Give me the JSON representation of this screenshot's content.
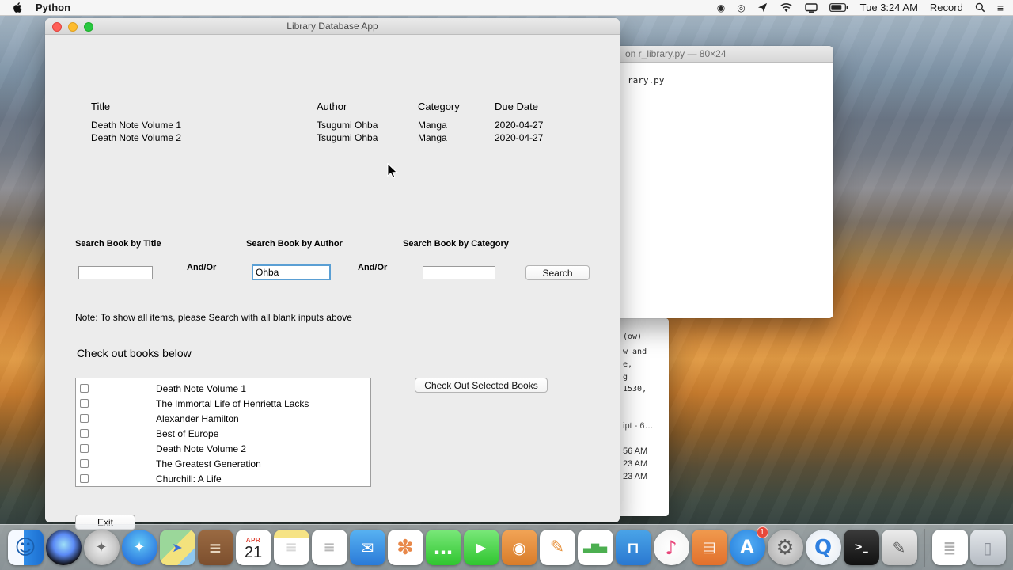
{
  "menu_bar": {
    "app_name": "Python",
    "time": "Tue 3:24 AM",
    "record_label": "Record",
    "icons": [
      "apple-logo",
      "record-stop",
      "screen-mirroring",
      "location",
      "wifi",
      "display",
      "battery",
      "spotlight-search",
      "notification-center"
    ]
  },
  "app_window": {
    "title": "Library Database App",
    "table": {
      "headers": [
        "Title",
        "Author",
        "Category",
        "Due Date"
      ],
      "rows": [
        [
          "Death Note Volume 1",
          "Tsugumi Ohba",
          "Manga",
          "2020-04-27"
        ],
        [
          "Death Note Volume 2",
          "Tsugumi Ohba",
          "Manga",
          "2020-04-27"
        ]
      ]
    },
    "search": {
      "title_label": "Search Book by Title",
      "author_label": "Search Book by Author",
      "category_label": "Search Book by Category",
      "and_or_1": "And/Or",
      "and_or_2": "And/Or",
      "title_value": "",
      "author_value": "Ohba",
      "category_value": "",
      "button": "Search"
    },
    "note": "Note: To show all items, please Search with all blank inputs above",
    "checkout_heading": "Check out books below",
    "books": [
      "Death Note Volume 1",
      "The Immortal Life of Henrietta Lacks",
      "Alexander Hamilton",
      "Best of Europe",
      "Death Note Volume 2",
      "The Greatest Generation",
      "Churchill: A Life"
    ],
    "checkout_button": "Check Out Selected Books",
    "exit_button": "Exit"
  },
  "terminal_window": {
    "title": "on r_library.py — 80×24",
    "visible_line": "rary.py"
  },
  "background_window_fragments": [
    "(ow)",
    "w and",
    "e,",
    "g",
    "1530,",
    "ipt - 6…",
    "56 AM",
    "23 AM",
    "23 AM"
  ],
  "dock": {
    "items": [
      {
        "name": "finder",
        "bg": "linear-gradient(90deg,#f5f9ff 0%,#f5f9ff 45%,#2f8ce8 45%,#1b6ed0 100%)",
        "glyph": "☺",
        "fg": "#1a5fae",
        "size": 26
      },
      {
        "name": "siri",
        "bg": "radial-gradient(circle at 50% 42%,#9fe0f7 0%,#5b8af5 38%,#12131a 72%)",
        "round": true
      },
      {
        "name": "launchpad",
        "bg": "radial-gradient(circle,#f2f2f2 0%,#c9c9c9 55%,#939393 100%)",
        "round": true,
        "glyph": "✦",
        "fg": "#6b6b6b",
        "size": 18
      },
      {
        "name": "safari",
        "bg": "radial-gradient(circle at 50% 38%,#62c8f7 0%,#2f7de0 70%,#1d5fc0 100%)",
        "round": true,
        "glyph": "✦",
        "fg": "#ffffff",
        "size": 18
      },
      {
        "name": "maps",
        "bg": "linear-gradient(135deg,#9bd79a 0%,#9bd79a 45%,#f3e27d 45%,#f3e27d 75%,#8fc7ee 75%)",
        "glyph": "➤",
        "fg": "#3a6fd8",
        "size": 16
      },
      {
        "name": "contacts",
        "bg": "linear-gradient(180deg,#9a6a42 0%,#7c4f2e 100%)",
        "glyph": "≡",
        "fg": "#e8d7c0",
        "size": 20
      },
      {
        "name": "calendar",
        "type": "calendar",
        "bg": "#ffffff",
        "month": "APR",
        "day": "21"
      },
      {
        "name": "notes",
        "bg": "linear-gradient(180deg,#f6e385 0%,#f6e385 24%,#ffffff 24%)",
        "glyph": "≡",
        "fg": "#d8d8d8",
        "size": 18
      },
      {
        "name": "reminders",
        "bg": "#ffffff",
        "glyph": "≡",
        "fg": "#b8b8b8",
        "size": 18
      },
      {
        "name": "mail",
        "bg": "linear-gradient(180deg,#58b2f2 0%,#2a7ad8 100%)",
        "glyph": "✉",
        "fg": "#ffffff",
        "size": 20
      },
      {
        "name": "photos",
        "bg": "#ffffff",
        "glyph": "✽",
        "fg": "#e8884a",
        "size": 26
      },
      {
        "name": "messages",
        "bg": "linear-gradient(180deg,#7ae87a 0%,#2fc52f 100%)",
        "glyph": "…",
        "fg": "#ffffff",
        "size": 24
      },
      {
        "name": "facetime",
        "bg": "linear-gradient(180deg,#7ae87a 0%,#2fc52f 100%)",
        "glyph": "▶",
        "fg": "#ffffff",
        "size": 16
      },
      {
        "name": "photo-booth",
        "bg": "linear-gradient(180deg,#f2a456 0%,#d87c2a 100%)",
        "glyph": "◉",
        "fg": "#ffffff",
        "size": 20
      },
      {
        "name": "pages",
        "bg": "#ffffff",
        "glyph": "✎",
        "fg": "#e89440",
        "size": 22
      },
      {
        "name": "numbers",
        "bg": "#ffffff",
        "glyph": "▃▆▄",
        "fg": "#4caf50",
        "size": 13
      },
      {
        "name": "keynote",
        "bg": "linear-gradient(180deg,#4aa4e8 0%,#2a78d0 100%)",
        "glyph": "⊓",
        "fg": "#ffffff",
        "size": 20
      },
      {
        "name": "itunes",
        "bg": "radial-gradient(circle,#ffffff 0%,#f2f2f2 100%)",
        "round": true,
        "glyph": "♪",
        "fg": "#e8457a",
        "size": 24
      },
      {
        "name": "books",
        "bg": "linear-gradient(180deg,#f09a4e 0%,#e2702c 100%)",
        "glyph": "▤",
        "fg": "#ffffff",
        "size": 18
      },
      {
        "name": "app-store",
        "bg": "radial-gradient(circle at 50% 40%,#54aef5 0%,#1f78d8 100%)",
        "round": true,
        "glyph": "A",
        "fg": "#ffffff",
        "size": 22,
        "badge": "1"
      },
      {
        "name": "system-preferences",
        "bg": "radial-gradient(circle,#e0e0e0 0%,#a8a8a8 100%)",
        "round": true,
        "glyph": "⚙",
        "fg": "#5a5a5a",
        "size": 26
      },
      {
        "name": "quicktime",
        "bg": "radial-gradient(circle,#ffffff 0%,#eef2f7 60%,#d7e2ee 100%)",
        "round": true,
        "glyph": "Q",
        "fg": "#2f80e0",
        "size": 26
      },
      {
        "name": "terminal",
        "bg": "linear-gradient(180deg,#3a3a3a 0%,#111111 100%)",
        "glyph": ">_",
        "fg": "#ffffff",
        "size": 13
      },
      {
        "name": "script-editor",
        "bg": "linear-gradient(180deg,#ececec 0%,#bdbdbd 100%)",
        "glyph": "✎",
        "fg": "#5a5a5a",
        "size": 20
      },
      {
        "type": "divider"
      },
      {
        "name": "documents",
        "bg": "#ffffff",
        "glyph": "≣",
        "fg": "#b0b0b0",
        "size": 20
      },
      {
        "name": "trash",
        "bg": "linear-gradient(180deg,rgba(235,238,242,0.9) 0%,rgba(186,192,200,0.9) 100%)",
        "glyph": "▯",
        "fg": "#8a8f98",
        "size": 20
      }
    ]
  }
}
